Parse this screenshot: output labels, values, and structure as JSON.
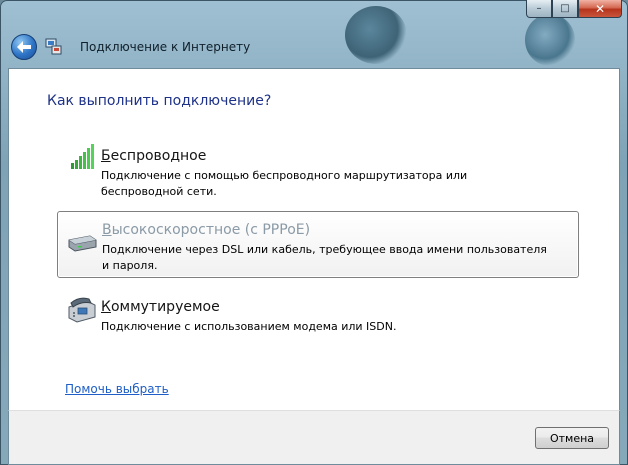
{
  "window": {
    "title": "Подключение к Интернету",
    "caption": {
      "minimize": "–",
      "maximize": "□",
      "close": "✕"
    }
  },
  "heading": "Как выполнить подключение?",
  "options": [
    {
      "icon": "wireless-signal-icon",
      "title_first_letter": "Б",
      "title_rest": "еспроводное",
      "description": "Подключение с помощью беспроводного маршрутизатора или беспроводной сети."
    },
    {
      "icon": "broadband-modem-icon",
      "title_first_letter": "В",
      "title_rest": "ысокоскоростное (с PPPoE)",
      "description": "Подключение через DSL или кабель, требующее ввода имени пользователя и пароля.",
      "selected": true
    },
    {
      "icon": "dialup-phone-icon",
      "title_first_letter": "К",
      "title_rest": "оммутируемое",
      "description": "Подключение с использованием модема или ISDN."
    }
  ],
  "help_link": "Помочь выбрать",
  "cancel_button": "Отмена",
  "colors": {
    "heading": "#1e3287",
    "link": "#1e5ec6",
    "disabled_title": "#8a9aa6"
  }
}
